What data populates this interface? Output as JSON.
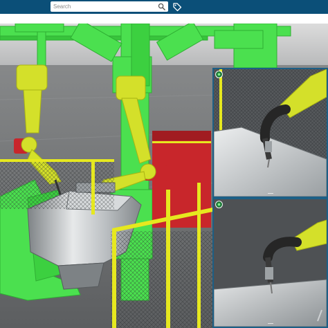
{
  "toolbar": {
    "search": {
      "placeholder": "Search"
    },
    "icons": {
      "search": "search-icon",
      "tag": "tag-icon"
    }
  },
  "colors": {
    "toolbar_bg": "#0b4f78",
    "gantry_green": "#4be04f",
    "robot_yellow": "#d4e02a",
    "fence_yellow": "#e6e81f",
    "cell_red": "#c8262b",
    "inset_border": "#1c5f86"
  },
  "insets": [
    {
      "name": "closeup-camera-view-1",
      "pin_icon": "pin-icon"
    },
    {
      "name": "closeup-camera-view-2",
      "pin_icon": "pin-icon"
    }
  ]
}
